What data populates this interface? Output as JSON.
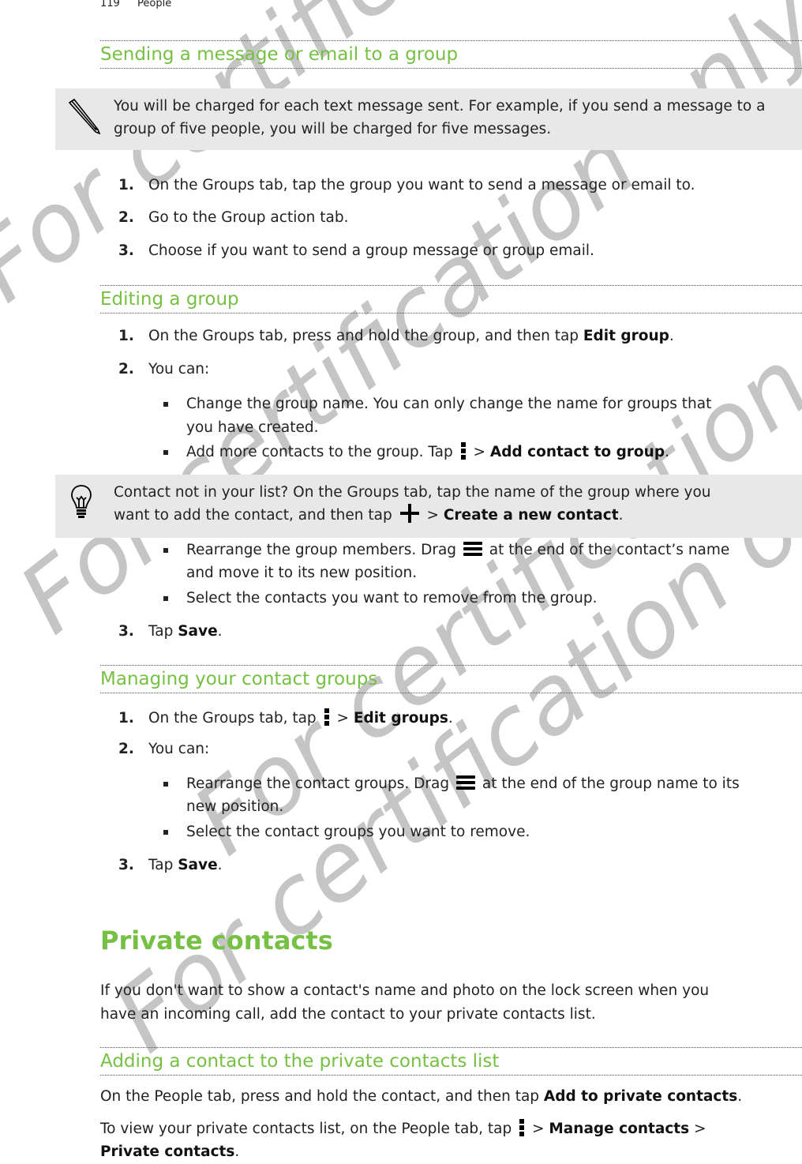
{
  "header": {
    "page_number": "119",
    "chapter": "People"
  },
  "sections": {
    "sending": {
      "title": "Sending a message or email to a group",
      "note": "You will be charged for each text message sent. For example, if you send a message to a group of five people, you will be charged for five messages.",
      "steps": [
        {
          "num": "1.",
          "text": "On the Groups tab, tap the group you want to send a message or email to."
        },
        {
          "num": "2.",
          "text": "Go to the Group action tab."
        },
        {
          "num": "3.",
          "text": "Choose if you want to send a group message or group email."
        }
      ]
    },
    "editing": {
      "title": "Editing a group",
      "step1": {
        "num": "1.",
        "pre": "On the Groups tab, press and hold the group, and then tap ",
        "em": "Edit group",
        "post": "."
      },
      "step2": {
        "num": "2.",
        "text": "You can:"
      },
      "bullets": {
        "b1_line1": "Change the group name. You can only change the name for groups that",
        "b1_line2": "you have created.",
        "b2_pre": "Add more contacts to the group. Tap ",
        "b2_mid": " > ",
        "b2_em": "Add contact to group",
        "b2_post": ".",
        "b3_pre": "Rearrange the group members. Drag ",
        "b3_post": " at the end of the contact’s name",
        "b3_line2": "and move it to its new position.",
        "b4": "Select the contacts you want to remove from the group."
      },
      "tip": {
        "line1": "Contact not in your list? On the Groups tab, tap the name of the group where you",
        "line2_pre": "want to add the contact, and then tap ",
        "line2_mid": " > ",
        "line2_em": "Create a new contact",
        "line2_post": "."
      },
      "step3": {
        "num": "3.",
        "pre": "Tap ",
        "em": "Save",
        "post": "."
      }
    },
    "managing": {
      "title": "Managing your contact groups",
      "step1": {
        "num": "1.",
        "pre": "On the Groups tab, tap ",
        "mid": " > ",
        "em": "Edit groups",
        "post": "."
      },
      "step2": {
        "num": "2.",
        "text": "You can:"
      },
      "b1_pre": "Rearrange the contact groups. Drag ",
      "b1_post": " at the end of the group name to its",
      "b1_line2": "new position.",
      "b2": "Select the contact groups you want to remove.",
      "step3": {
        "num": "3.",
        "pre": "Tap ",
        "em": "Save",
        "post": "."
      }
    },
    "private": {
      "title": "Private contacts",
      "intro_line1": "If you don't want to show a contact's name and photo on the lock screen when you",
      "intro_line2": "have an incoming call, add the contact to your private contacts list.",
      "adding": {
        "title": "Adding a contact to the private contacts list",
        "p1_pre": "On the People tab, press and hold the contact, and then tap ",
        "p1_em": "Add to private contacts",
        "p1_post": ".",
        "p2_pre": "To view your private contacts list, on the People tab, tap ",
        "p2_mid": " > ",
        "p2_em1": "Manage contacts",
        "p2_sep": " >",
        "p2_em2": "Private contacts",
        "p2_post": "."
      }
    }
  },
  "watermark": {
    "text": "For certification only",
    "color": "#969696"
  },
  "colors": {
    "heading": "#76c043",
    "note_bg": "#e8e8e8",
    "text": "#222222"
  }
}
